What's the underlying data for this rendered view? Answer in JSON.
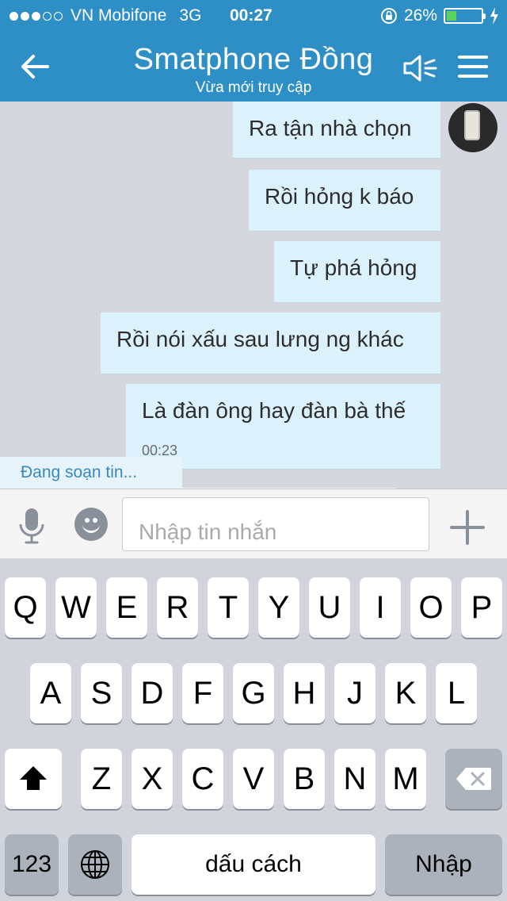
{
  "status_bar": {
    "carrier": "VN Mobifone",
    "network": "3G",
    "time": "00:27",
    "battery": "26%",
    "battery_level": 0.26,
    "signal_bars_filled": 3,
    "signal_bars_total": 5
  },
  "header": {
    "title": "Smatphone Đồng",
    "subtitle": "Vừa mới truy cập"
  },
  "messages": [
    {
      "text": "Ra tận nhà chọn"
    },
    {
      "text": "Rồi hỏng k báo"
    },
    {
      "text": "Tự phá hỏng"
    },
    {
      "text": "Rồi nói xấu sau lưng ng khác"
    },
    {
      "text": "Là đàn ông hay đàn bà thế",
      "time": "00:23"
    }
  ],
  "typing_indicator": "Đang soạn tin...",
  "composer": {
    "placeholder": "Nhập tin nhắn"
  },
  "keyboard": {
    "row1": [
      "Q",
      "W",
      "E",
      "R",
      "T",
      "Y",
      "U",
      "I",
      "O",
      "P"
    ],
    "row2": [
      "A",
      "S",
      "D",
      "F",
      "G",
      "H",
      "J",
      "K",
      "L"
    ],
    "row3": [
      "Z",
      "X",
      "C",
      "V",
      "B",
      "N",
      "M"
    ],
    "numbers_key": "123",
    "space_key": "dấu cách",
    "return_key": "Nhập"
  },
  "colors": {
    "header": "#2e8fc6",
    "bubble": "#dbf2fc",
    "typing_text": "#3a88c0",
    "battery_fill": "#5bd35b"
  },
  "icons": [
    "back-arrow-icon",
    "speaker-icon",
    "menu-icon",
    "microphone-icon",
    "emoji-icon",
    "plus-icon",
    "shift-icon",
    "globe-icon",
    "backspace-icon",
    "lock-rotation-icon",
    "charging-icon"
  ]
}
